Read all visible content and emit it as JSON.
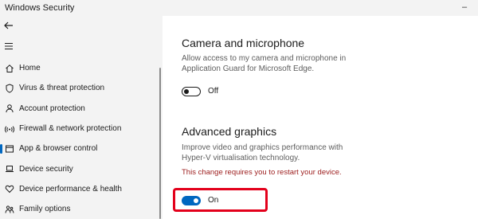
{
  "window": {
    "title": "Windows Security"
  },
  "sidebar": {
    "items": [
      {
        "label": "Home",
        "icon": "home-icon"
      },
      {
        "label": "Virus & threat protection",
        "icon": "shield-icon"
      },
      {
        "label": "Account protection",
        "icon": "person-icon"
      },
      {
        "label": "Firewall & network protection",
        "icon": "wifi-icon"
      },
      {
        "label": "App & browser control",
        "icon": "app-window-icon",
        "selected": true
      },
      {
        "label": "Device security",
        "icon": "laptop-icon"
      },
      {
        "label": "Device performance & health",
        "icon": "heart-icon"
      },
      {
        "label": "Family options",
        "icon": "family-icon"
      }
    ]
  },
  "main": {
    "camera": {
      "title": "Camera and microphone",
      "description": "Allow access to my camera and microphone in Application Guard for Microsoft Edge.",
      "toggle_label": "Off",
      "toggle_state": "off"
    },
    "graphics": {
      "title": "Advanced graphics",
      "description": "Improve video and graphics performance with Hyper-V virtualisation technology.",
      "warning": "This change requires you to restart your device.",
      "toggle_label": "On",
      "toggle_state": "on"
    }
  },
  "colors": {
    "accent": "#0067c0",
    "highlight": "#e3001b",
    "warning": "#9c1c1c"
  }
}
